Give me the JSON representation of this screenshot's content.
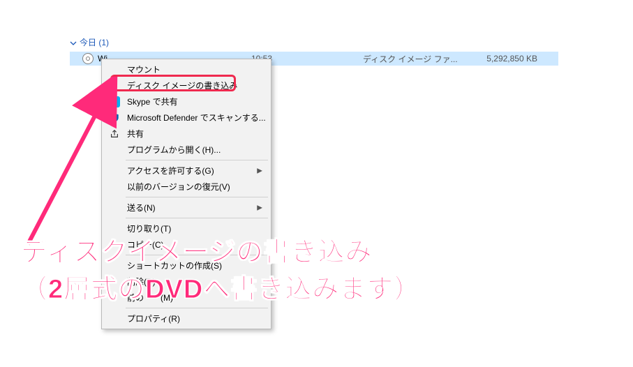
{
  "group": {
    "label": "今日 (1)"
  },
  "file": {
    "name": "Wi",
    "date": "10:53",
    "type": "ディスク イメージ ファ...",
    "size": "5,292,850 KB"
  },
  "menu": {
    "mount": "マウント",
    "burn_image": "ディスク イメージの書き込み",
    "skype_share": "Skype で共有",
    "defender_scan": "Microsoft Defender でスキャンする...",
    "share": "共有",
    "open_with": "プログラムから開く(H)...",
    "grant_access": "アクセスを許可する(G)",
    "restore_versions": "以前のバージョンの復元(V)",
    "send_to": "送る(N)",
    "cut": "切り取り(T)",
    "copy": "コピー(C)",
    "create_shortcut": "ショートカットの作成(S)",
    "delete": "削除(D)",
    "rename_pre": "前の",
    "rename_post": "(M)",
    "properties": "プロパティ(R)"
  },
  "annotation": {
    "line1": "ディスクイメージの書き込み",
    "line2": "（2層式のDVDへ書き込みます）"
  }
}
